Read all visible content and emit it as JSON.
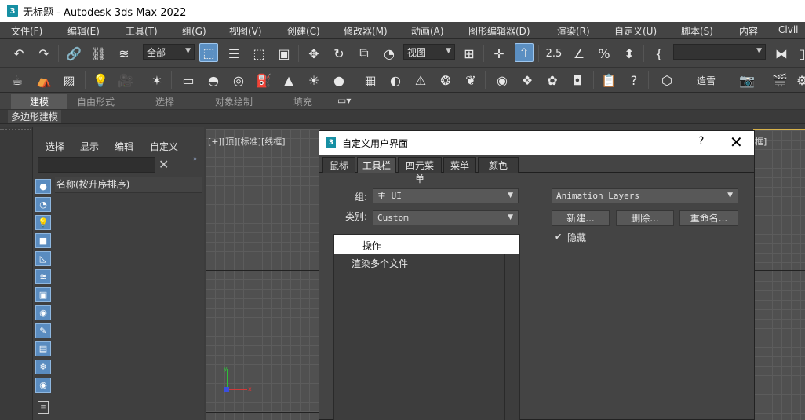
{
  "app": {
    "window_title": "无标题 - Autodesk 3ds Max 2022",
    "logo_text": "3"
  },
  "menu": {
    "items": [
      "文件(F)",
      "编辑(E)",
      "工具(T)",
      "组(G)",
      "视图(V)",
      "创建(C)",
      "修改器(M)",
      "动画(A)",
      "图形编辑器(D)",
      "渲染(R)",
      "自定义(U)",
      "脚本(S)",
      "内容",
      "Civil"
    ]
  },
  "toolbar1": {
    "selection_filter": "全部",
    "reference_coord": "视图",
    "snap_value": "2.5",
    "named_selection": ""
  },
  "toolbar2": {
    "shading_label": "造雪"
  },
  "ribbon": {
    "tabs": [
      "建模",
      "自由形式",
      "选择",
      "对象绘制",
      "填充"
    ],
    "active_tab": "建模",
    "sub_label": "多边形建模"
  },
  "explorer": {
    "menu": [
      "选择",
      "显示",
      "编辑",
      "自定义"
    ],
    "search_value": "",
    "column_header": "名称(按升序排序)",
    "icons": [
      "sphere-icon",
      "shapes-icon",
      "light-icon",
      "camera-icon",
      "helper-icon",
      "spacewarp-icon",
      "group-icon",
      "xref-icon",
      "bone-icon",
      "container-icon",
      "frozen-icon",
      "hidden-icon"
    ]
  },
  "viewport": {
    "left_label": "[+][顶][标准][线框]",
    "right_label": "框]",
    "axis_y": "y",
    "axis_x": "x"
  },
  "dialog": {
    "title": "自定义用户界面",
    "help": "?",
    "close": "✕",
    "tabs": [
      "鼠标",
      "工具栏",
      "四元菜单",
      "菜单",
      "颜色"
    ],
    "active_tab": "工具栏",
    "group_label": "组:",
    "group_value": "主 UI",
    "category_label": "类别:",
    "category_value": "Custom",
    "list_items": [
      "操作",
      "渲染多个文件"
    ],
    "selected_item": "操作",
    "toolbar_dropdown": "Animation Layers",
    "new_button": "新建...",
    "delete_button": "删除...",
    "rename_button": "重命名...",
    "hidden_checkbox_label": "隐藏",
    "hidden_checked": true
  }
}
